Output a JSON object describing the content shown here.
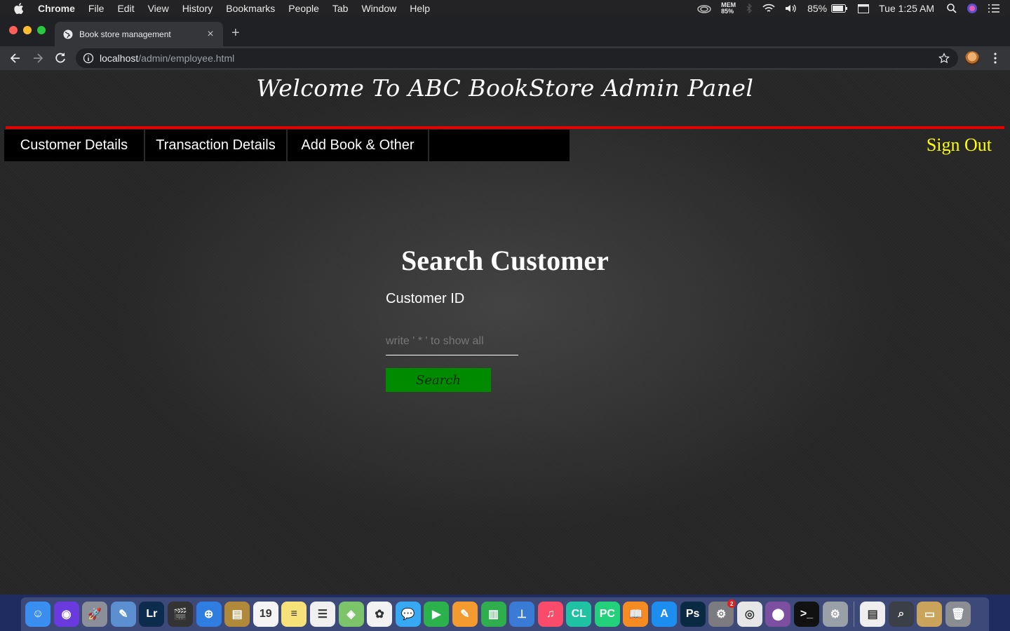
{
  "menubar": {
    "items": [
      "Chrome",
      "File",
      "Edit",
      "View",
      "History",
      "Bookmarks",
      "People",
      "Tab",
      "Window",
      "Help"
    ],
    "mem_label": "MEM",
    "mem_value": "85%",
    "battery": "85%",
    "clock": "Tue 1:25 AM"
  },
  "browser": {
    "tab_title": "Book store management",
    "tab_close": "×",
    "new_tab": "+",
    "url_host": "localhost",
    "url_path": "/admin/employee.html"
  },
  "page": {
    "header_title": "Welcome To ABC BookStore Admin Panel",
    "nav_items": [
      {
        "label": "Customer Details"
      },
      {
        "label": "Transaction Details"
      },
      {
        "label": "Add Book & Other"
      },
      {
        "label": ""
      }
    ],
    "sign_out": "Sign Out",
    "search_title": "Search Customer",
    "customer_id_label": "Customer ID",
    "customer_id_placeholder": "write ' * ' to show all",
    "customer_id_value": "",
    "search_button": "Search"
  },
  "colors": {
    "accent_line": "#e10000",
    "sign_out": "#ffff00",
    "search_button_bg": "#008a00"
  },
  "dock": {
    "apps": [
      {
        "name": "finder-icon",
        "color": "#3a8ef0",
        "glyph": "☺"
      },
      {
        "name": "siri-icon",
        "color": "#6a3adf",
        "glyph": "◉"
      },
      {
        "name": "launchpad-icon",
        "color": "#8a8f99",
        "glyph": "🚀"
      },
      {
        "name": "preview-icon",
        "color": "#5b8fd0",
        "glyph": "✎"
      },
      {
        "name": "lightroom-icon",
        "color": "#0d2b4d",
        "glyph": "Lr"
      },
      {
        "name": "final-cut-icon",
        "color": "#333333",
        "glyph": "🎬"
      },
      {
        "name": "safari-icon",
        "color": "#2f7de1",
        "glyph": "⊕"
      },
      {
        "name": "notefile-icon",
        "color": "#b08a3a",
        "glyph": "▤"
      },
      {
        "name": "calendar-icon",
        "color": "#f4f4f4",
        "glyph": "19"
      },
      {
        "name": "notes-icon",
        "color": "#f7e27a",
        "glyph": "≡"
      },
      {
        "name": "reminders-icon",
        "color": "#f0f0f0",
        "glyph": "☰"
      },
      {
        "name": "maps-icon",
        "color": "#7cc46a",
        "glyph": "◈"
      },
      {
        "name": "photos-icon",
        "color": "#f2f2f2",
        "glyph": "✿"
      },
      {
        "name": "messages-icon",
        "color": "#36a9f2",
        "glyph": "💬"
      },
      {
        "name": "facetime-icon",
        "color": "#2bb24c",
        "glyph": "▶"
      },
      {
        "name": "pages-icon",
        "color": "#f39b2f",
        "glyph": "✎"
      },
      {
        "name": "numbers-icon",
        "color": "#2fae4e",
        "glyph": "▥"
      },
      {
        "name": "keynote-icon",
        "color": "#3a7bd5",
        "glyph": "⊥"
      },
      {
        "name": "music-icon",
        "color": "#fa4b6a",
        "glyph": "♫"
      },
      {
        "name": "clion-icon",
        "color": "#21c2a3",
        "glyph": "CL"
      },
      {
        "name": "pycharm-icon",
        "color": "#22d17a",
        "glyph": "PC"
      },
      {
        "name": "books-icon",
        "color": "#f58c21",
        "glyph": "📖"
      },
      {
        "name": "app-store-icon",
        "color": "#1c8ef0",
        "glyph": "A"
      },
      {
        "name": "photoshop-icon",
        "color": "#0a2a44",
        "glyph": "Ps"
      },
      {
        "name": "system-preferences-icon",
        "color": "#7b7b80",
        "glyph": "⚙",
        "badge": "2"
      },
      {
        "name": "chrome-icon",
        "color": "#e6e6e6",
        "glyph": "◎"
      },
      {
        "name": "tor-browser-icon",
        "color": "#7d4fa0",
        "glyph": "⬤"
      },
      {
        "name": "terminal-icon",
        "color": "#111111",
        "glyph": ">_"
      },
      {
        "name": "settings-gear-icon",
        "color": "#9aa0a8",
        "glyph": "⚙"
      },
      {
        "name": "separator",
        "color": "",
        "glyph": ""
      },
      {
        "name": "document-icon",
        "color": "#eeeeee",
        "glyph": "▤"
      },
      {
        "name": "screenshot-icon",
        "color": "#3b3f48",
        "glyph": "⌕"
      },
      {
        "name": "folder-icon",
        "color": "#c9a45a",
        "glyph": "▭"
      },
      {
        "name": "trash-icon",
        "color": "#8a8d92",
        "glyph": "🗑"
      }
    ]
  }
}
